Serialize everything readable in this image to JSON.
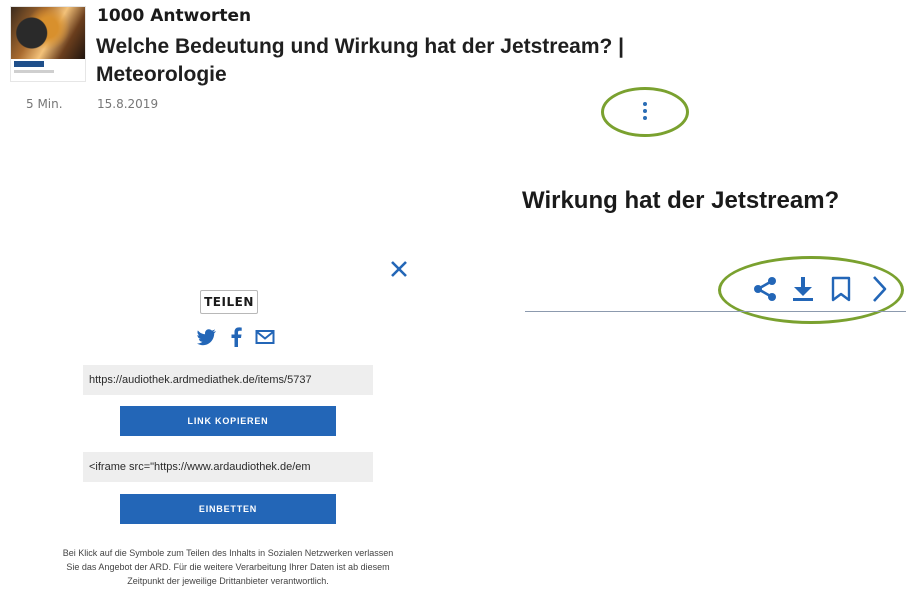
{
  "episode": {
    "series": "1000 Antworten",
    "title": "Welche Bedeutung und Wirkung hat der Jetstream? | Meteorologie",
    "duration": "5 Min.",
    "date": "15.8.2019",
    "more_icon": "more-vertical-icon"
  },
  "detail": {
    "title_cropped": "Wirkung hat der Jetstream?",
    "actions": [
      {
        "icon": "share-icon"
      },
      {
        "icon": "download-icon"
      },
      {
        "icon": "bookmark-icon"
      },
      {
        "icon": "chevron-right-icon"
      }
    ]
  },
  "share_dialog": {
    "heading": "TEILEN",
    "close_icon": "close-icon",
    "social": [
      "twitter-icon",
      "facebook-icon",
      "mail-icon"
    ],
    "link_value": "https://audiothek.ardmediathek.de/items/5737",
    "copy_label": "LINK KOPIEREN",
    "embed_value": "<iframe src=\"https://www.ardaudiothek.de/em",
    "embed_label": "EINBETTEN",
    "disclaimer": "Bei Klick auf die Symbole zum Teilen des Inhalts in Sozialen Netzwerken verlassen Sie das Angebot der ARD. Für die weitere Verarbeitung Ihrer Daten ist ab diesem Zeitpunkt der jeweilige Drittanbieter verantwortlich."
  },
  "colors": {
    "accent": "#2366b7",
    "highlight": "#7aa12f",
    "field_bg": "#eeeeee"
  }
}
